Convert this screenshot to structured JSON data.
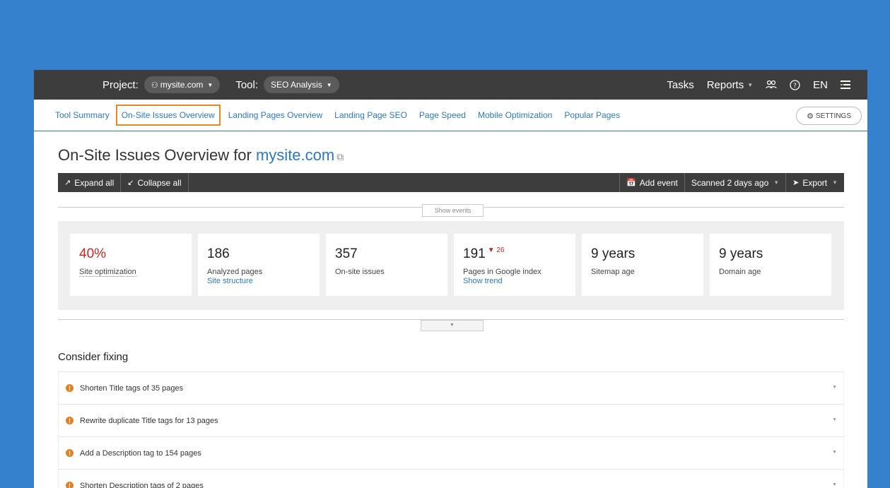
{
  "topbar": {
    "project_label": "Project:",
    "project_value": "mysite.com",
    "tool_label": "Tool:",
    "tool_value": "SEO Analysis",
    "tasks": "Tasks",
    "reports": "Reports",
    "lang": "EN"
  },
  "tabs": [
    {
      "label": "Tool Summary"
    },
    {
      "label": "On-Site Issues Overview"
    },
    {
      "label": "Landing Pages Overview"
    },
    {
      "label": "Landing Page SEO"
    },
    {
      "label": "Page Speed"
    },
    {
      "label": "Mobile Optimization"
    },
    {
      "label": "Popular Pages"
    }
  ],
  "settings_label": "SETTINGS",
  "page": {
    "title_prefix": "On-Site Issues Overview for ",
    "title_site": "mysite.com"
  },
  "toolbar": {
    "expand": "Expand all",
    "collapse": "Collapse all",
    "add_event": "Add event",
    "scanned": "Scanned 2 days ago",
    "export": "Export"
  },
  "show_events": "Show events",
  "metrics": [
    {
      "value": "40%",
      "label": "Site optimization",
      "link": ""
    },
    {
      "value": "186",
      "label": "Analyzed pages",
      "link": "Site structure"
    },
    {
      "value": "357",
      "label": "On-site issues",
      "link": ""
    },
    {
      "value": "191",
      "delta": "26",
      "label": "Pages in Google index",
      "link": "Show trend"
    },
    {
      "value": "9 years",
      "label": "Sitemap age",
      "link": ""
    },
    {
      "value": "9 years",
      "label": "Domain age",
      "link": ""
    }
  ],
  "section_title": "Consider fixing",
  "issues": [
    {
      "text": "Shorten Title tags of 35 pages"
    },
    {
      "text": "Rewrite duplicate Title tags for 13 pages"
    },
    {
      "text": "Add a Description tag to 154 pages"
    },
    {
      "text": "Shorten Description tags of 2 pages"
    }
  ],
  "colors": {
    "background": "#3581cd",
    "accent": "#2a79c9",
    "active_tab_border": "#e68a1f",
    "danger": "#c62626",
    "warning": "#e67e22"
  }
}
